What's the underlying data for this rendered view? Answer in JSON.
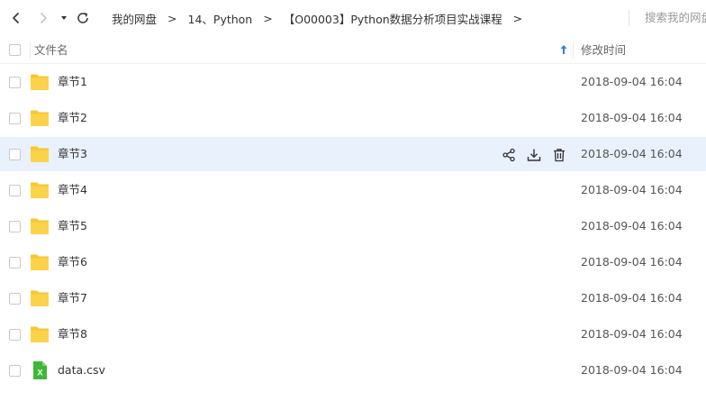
{
  "breadcrumb": [
    "我的网盘",
    "14、Python",
    "【O00003】Python数据分析项目实战课程"
  ],
  "breadcrumb_separator": ">",
  "search": {
    "placeholder": "搜索我的网盘"
  },
  "header": {
    "name": "文件名",
    "time": "修改时间"
  },
  "files": [
    {
      "name": "章节1",
      "time": "2018-09-04 16:04",
      "type": "folder"
    },
    {
      "name": "章节2",
      "time": "2018-09-04 16:04",
      "type": "folder"
    },
    {
      "name": "章节3",
      "time": "2018-09-04 16:04",
      "type": "folder"
    },
    {
      "name": "章节4",
      "time": "2018-09-04 16:04",
      "type": "folder"
    },
    {
      "name": "章节5",
      "time": "2018-09-04 16:04",
      "type": "folder"
    },
    {
      "name": "章节6",
      "time": "2018-09-04 16:04",
      "type": "folder"
    },
    {
      "name": "章节7",
      "time": "2018-09-04 16:04",
      "type": "folder"
    },
    {
      "name": "章节8",
      "time": "2018-09-04 16:04",
      "type": "folder"
    },
    {
      "name": "data.csv",
      "time": "2018-09-04 16:04",
      "type": "csv"
    }
  ],
  "colors": {
    "folder": "#f8c630",
    "csv": "#3fb837",
    "hover_row": "#e9f1fd",
    "accent": "#2f7bf5"
  },
  "icons": {
    "csv_letter": "X"
  }
}
